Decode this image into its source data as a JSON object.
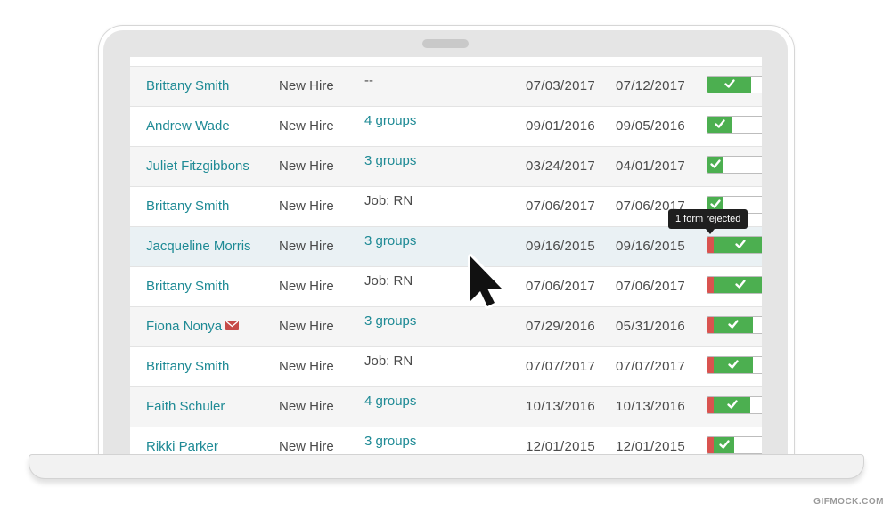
{
  "rows": [
    {
      "name": "Brittany Smith",
      "type": "New Hire",
      "groups": "--",
      "groups_link": false,
      "start": "07/03/2017",
      "due": "07/12/2017",
      "progress": 0.74,
      "rejected": 0,
      "mail": false
    },
    {
      "name": "Andrew Wade",
      "type": "New Hire",
      "groups": "4 groups",
      "groups_link": true,
      "start": "09/01/2016",
      "due": "09/05/2016",
      "progress": 0.42,
      "rejected": 0,
      "mail": false
    },
    {
      "name": "Juliet Fitzgibbons",
      "type": "New Hire",
      "groups": "3 groups",
      "groups_link": true,
      "start": "03/24/2017",
      "due": "04/01/2017",
      "progress": 0.26,
      "rejected": 0,
      "mail": false
    },
    {
      "name": "Brittany Smith",
      "type": "New Hire",
      "groups": "Job: RN",
      "groups_link": false,
      "start": "07/06/2017",
      "due": "07/06/2017",
      "progress": 0.26,
      "rejected": 0,
      "mail": false
    },
    {
      "name": "Jacqueline Morris",
      "type": "New Hire",
      "groups": "3 groups",
      "groups_link": true,
      "start": "09/16/2015",
      "due": "09/16/2015",
      "progress": 1.0,
      "rejected": 1,
      "mail": false
    },
    {
      "name": "Brittany Smith",
      "type": "New Hire",
      "groups": "Job: RN",
      "groups_link": false,
      "start": "07/06/2017",
      "due": "07/06/2017",
      "progress": 1.0,
      "rejected": 1,
      "mail": false
    },
    {
      "name": "Fiona Nonya",
      "type": "New Hire",
      "groups": "3 groups",
      "groups_link": true,
      "start": "07/29/2016",
      "due": "05/31/2016",
      "progress": 0.78,
      "rejected": 1,
      "mail": true
    },
    {
      "name": "Brittany Smith",
      "type": "New Hire",
      "groups": "Job: RN",
      "groups_link": false,
      "start": "07/07/2017",
      "due": "07/07/2017",
      "progress": 0.78,
      "rejected": 1,
      "mail": false
    },
    {
      "name": "Faith Schuler",
      "type": "New Hire",
      "groups": "4 groups",
      "groups_link": true,
      "start": "10/13/2016",
      "due": "10/13/2016",
      "progress": 0.72,
      "rejected": 1,
      "mail": false
    },
    {
      "name": "Rikki Parker",
      "type": "New Hire",
      "groups": "3 groups",
      "groups_link": true,
      "start": "12/01/2015",
      "due": "12/01/2015",
      "progress": 0.46,
      "rejected": 1,
      "mail": false
    }
  ],
  "tooltip": {
    "text": "1 form rejected",
    "row_index": 4
  },
  "watermark": "GIFMOCK.COM",
  "colors": {
    "accent": "#1e8a95",
    "progress_green": "#4caf50",
    "rejected_red": "#d9534f",
    "mail_red": "#c64b48"
  },
  "icons": {
    "check": "check-icon",
    "mail": "mail-icon",
    "cursor": "mouse-pointer-icon"
  }
}
